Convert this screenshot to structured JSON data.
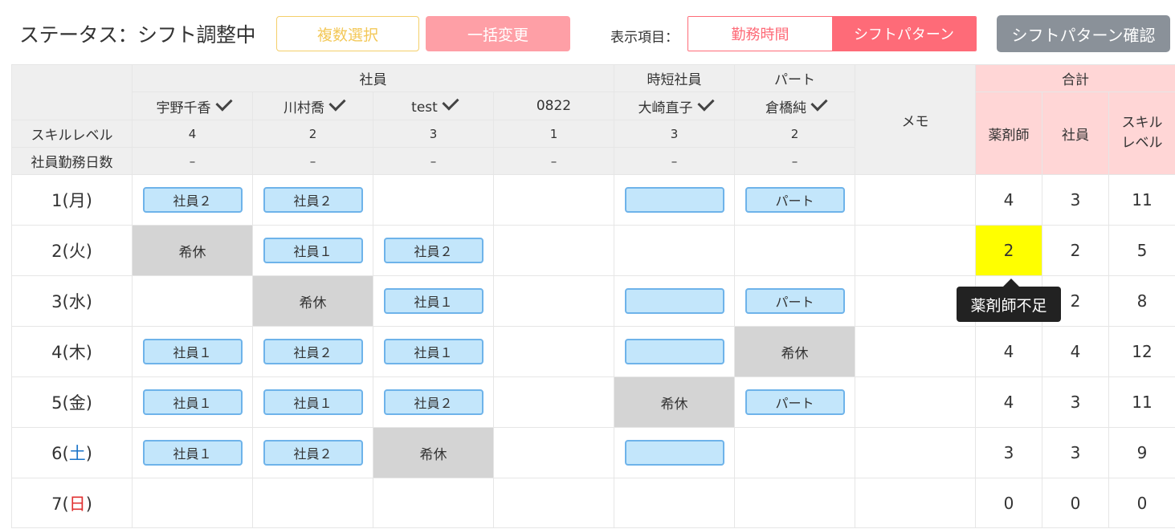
{
  "topbar": {
    "status_text": "ステータス：シフト調整中",
    "multi_select_label": "複数選択",
    "bulk_change_label": "一括変更",
    "display_label": "表示項目：",
    "toggle_work_hours": "勤務時間",
    "toggle_shift_pattern": "シフトパターン",
    "confirm_label": "シフトパターン確認"
  },
  "header": {
    "groups": {
      "employee": "社員",
      "short_time": "時短社員",
      "part": "パート"
    },
    "memo": "メモ",
    "total": "合計",
    "total_cols": {
      "pharmacist": "薬剤師",
      "employee": "社員",
      "skill": "スキル\nレベル"
    },
    "skill_label": "スキルレベル",
    "workdays_label": "社員勤務日数",
    "staff": [
      {
        "name": "宇野千香",
        "skill": "4",
        "workdays": "–"
      },
      {
        "name": "川村喬",
        "skill": "2",
        "workdays": "–"
      },
      {
        "name": "test",
        "skill": "3",
        "workdays": "–"
      },
      {
        "name": "0822",
        "skill": "1",
        "workdays": "–"
      },
      {
        "name": "大崎直子",
        "skill": "3",
        "workdays": "–"
      },
      {
        "name": "倉橋純",
        "skill": "2",
        "workdays": "–"
      }
    ]
  },
  "days": [
    {
      "num": "1",
      "open": "(",
      "dow": "月",
      "close": ")",
      "cells": [
        "社員２",
        "社員２",
        "",
        "",
        "",
        "パート"
      ],
      "totals": [
        "4",
        "3",
        "11"
      ]
    },
    {
      "num": "2",
      "open": "(",
      "dow": "火",
      "close": ")",
      "cells": [
        "希休",
        "社員１",
        "社員２",
        "",
        "",
        ""
      ],
      "totals": [
        "2",
        "2",
        "5"
      ]
    },
    {
      "num": "3",
      "open": "(",
      "dow": "水",
      "close": ")",
      "cells": [
        "",
        "希休",
        "社員１",
        "",
        "",
        "パート"
      ],
      "totals": [
        "",
        "2",
        "8"
      ]
    },
    {
      "num": "4",
      "open": "(",
      "dow": "木",
      "close": ")",
      "cells": [
        "社員１",
        "社員２",
        "社員１",
        "",
        "",
        "希休"
      ],
      "totals": [
        "4",
        "4",
        "12"
      ]
    },
    {
      "num": "5",
      "open": "(",
      "dow": "金",
      "close": ")",
      "cells": [
        "社員１",
        "社員１",
        "社員２",
        "",
        "希休",
        "パート"
      ],
      "totals": [
        "4",
        "3",
        "11"
      ]
    },
    {
      "num": "6",
      "open": "(",
      "dow": "土",
      "close": ")",
      "cells": [
        "社員１",
        "社員２",
        "希休",
        "",
        "",
        ""
      ],
      "totals": [
        "3",
        "3",
        "9"
      ]
    },
    {
      "num": "7",
      "open": "(",
      "dow": "日",
      "close": ")",
      "cells": [
        "",
        "",
        "",
        "",
        "",
        ""
      ],
      "totals": [
        "0",
        "0",
        "0"
      ]
    }
  ],
  "tooltip": "薬剤師不足",
  "colors": {
    "accent": "#fe6b78",
    "warning": "#ffff00",
    "chip_bg": "#c3e6fb",
    "off_bg": "#d4d4d4",
    "saturday": "#1a73c8",
    "sunday": "#e03030"
  }
}
